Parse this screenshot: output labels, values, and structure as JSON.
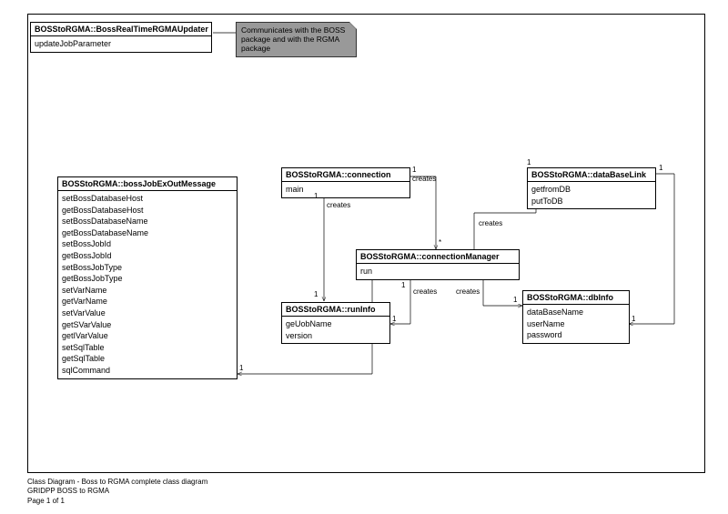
{
  "footer": {
    "title": "Class Diagram - Boss to RGMA complete class diagram",
    "project": "GRIDPP BOSS to RGMA",
    "page": "Page 1 of 1"
  },
  "note": {
    "text1": "Communicates with the BOSS",
    "text2": "package and with the RGMA",
    "text3": "package"
  },
  "classes": {
    "updater": {
      "title": "BOSStoRGMA::BossRealTimeRGMAUpdater",
      "m0": "updateJobParameter"
    },
    "msg": {
      "title": "BOSStoRGMA::bossJobExOutMessage",
      "m0": "setBossDatabaseHost",
      "m1": "getBossDatabaseHost",
      "m2": "setBossDatabaseName",
      "m3": "getBossDatabaseName",
      "m4": "setBossJobId",
      "m5": "getBossJobId",
      "m6": "setBossJobType",
      "m7": "getBossJobType",
      "m8": "setVarName",
      "m9": "getVarName",
      "m10": "setVarValue",
      "m11": "getSVarValue",
      "m12": "getIVarValue",
      "m13": "setSqlTable",
      "m14": "getSqlTable",
      "m15": "sqlCommand"
    },
    "conn": {
      "title": "BOSStoRGMA::connection",
      "m0": "main"
    },
    "connMgr": {
      "title": "BOSStoRGMA::connectionManager",
      "m0": "run"
    },
    "runInfo": {
      "title": "BOSStoRGMA::runInfo",
      "m0": "geUobName",
      "m1": "version"
    },
    "dbLink": {
      "title": "BOSStoRGMA::dataBaseLink",
      "m0": "getfromDB",
      "m1": "putToDB"
    },
    "dbInfo": {
      "title": "BOSStoRGMA::dbInfo",
      "m0": "dataBaseName",
      "m1": "userName",
      "m2": "password"
    }
  },
  "labels": {
    "creates": "creates",
    "one": "1",
    "star": "*"
  }
}
